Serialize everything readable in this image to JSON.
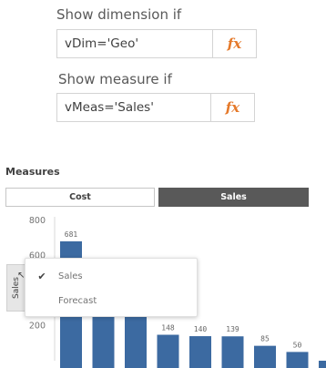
{
  "dimension_condition": {
    "label": "Show dimension if",
    "expression": "vDim='Geo'",
    "fx_icon": "fx"
  },
  "measure_condition": {
    "label": "Show measure if",
    "expression": "vMeas='Sales'",
    "fx_icon": "fx"
  },
  "measures_section": {
    "heading": "Measures",
    "buttons": [
      {
        "label": "Cost",
        "selected": false
      },
      {
        "label": "Sales",
        "selected": true
      }
    ]
  },
  "axis_label_button": {
    "label": "Sales",
    "icon": "cursor-icon"
  },
  "measure_popup": {
    "items": [
      {
        "label": "Sales",
        "checked": true
      },
      {
        "label": "Forecast",
        "checked": false
      }
    ]
  },
  "colors": {
    "bar": "#3c6aa1",
    "selected_button": "#595959",
    "fx_accent": "#e5792a"
  },
  "chart_data": {
    "type": "bar",
    "categories": [
      "",
      "",
      "",
      "",
      "",
      "",
      "",
      "",
      ""
    ],
    "values": [
      681,
      340,
      340,
      148,
      140,
      139,
      85,
      50,
      0
    ],
    "data_labels": [
      "681",
      "",
      "",
      "148",
      "140",
      "139",
      "85",
      "50",
      ""
    ],
    "ylim": [
      0,
      800
    ],
    "yticks": [
      "800",
      "600",
      "400",
      "200"
    ],
    "grid": false
  }
}
